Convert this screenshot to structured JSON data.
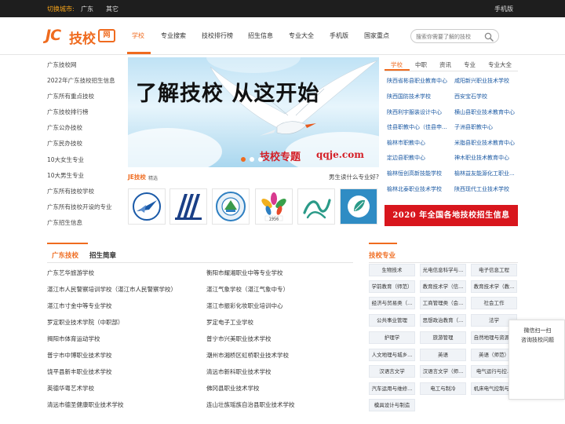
{
  "topbar": {
    "city_label": "切换城市:",
    "cities": [
      "广东",
      "其它"
    ],
    "mobile": "手机版"
  },
  "header": {
    "logo": {
      "jc": "JC",
      "word": "技校",
      "net": "网"
    },
    "nav": [
      "学校",
      "专业搜索",
      "技校排行榜",
      "招生信息",
      "专业大全",
      "手机版",
      "国家重点"
    ],
    "active_nav": 0,
    "search_placeholder": "搜索你需要了解的技校"
  },
  "left_list": [
    "广东技校网",
    "2022年广东技校招生信息",
    "广东所有重点技校",
    "广东技校排行榜",
    "广东公办技校",
    "广东民办技校",
    "10大女生专业",
    "10大男生专业",
    "广东所有技校学校",
    "广东所有技校开设的专业",
    "广东招生信息"
  ],
  "banner": {
    "headline": "了解技校 从这开始",
    "subline": "技校专题",
    "url": "qqje.com",
    "slide_count": 3,
    "active_slide": 0
  },
  "strip": {
    "brand": "JE技校",
    "brand_sub": "精选",
    "question": "男生读什么专业好?",
    "logo_colors": [
      "#1a5aa8",
      "#1a3f86",
      "#2e7fc1",
      "#d83a8f",
      "#2a9a88",
      "#2f8cc4"
    ],
    "logo_icons": [
      "plane-emblem-icon",
      "stripes-emblem-icon",
      "round-seal-icon",
      "flower-emblem-icon",
      "wave-emblem-icon",
      "circle-leaf-icon"
    ]
  },
  "right_tabs": [
    "学校",
    "中职",
    "资讯",
    "专业",
    "专业大全"
  ],
  "right_list": [
    [
      "陕西省彬县职业教育中心",
      "咸阳新兴职业技术学校"
    ],
    [
      "陕西国防技术学校",
      "西安宝石学校"
    ],
    [
      "陕西利宇服装设计中心",
      "横山县职业技术教育中心"
    ],
    [
      "佳县职教中心（佳县申...",
      "子洲县职教中心"
    ],
    [
      "榆林市职教中心",
      "米脂县职业技术教育中心"
    ],
    [
      "定边县职教中心",
      "神木职业技术教育中心"
    ],
    [
      "榆林恒创高新技能学校",
      "榆林益友能源化工职业..."
    ],
    [
      "榆林北泰职业技术学校",
      "陕西现代工业技术学校"
    ]
  ],
  "promo": "2020 年全国各地技校招生信息",
  "lower_tabs": [
    "广东技校",
    "招生简章"
  ],
  "schools": [
    [
      "广东艺华旅游学校",
      "衡阳市耀湘职业中等专业学校"
    ],
    [
      "湛江市人民警察培训学校（湛江市人民警察学校）",
      "湛江气象学校（湛江气象中专）"
    ],
    [
      "湛江市寸金中等专业学校",
      "湛江市振彩化妆职业培训中心"
    ],
    [
      "罗定职业技术学院（中职部）",
      "罗定电子工业学校"
    ],
    [
      "揭阳市体育运动学校",
      "普宁市兴美职业技术学校"
    ],
    [
      "普宁市中博职业技术学校",
      "潮州市湘桥区虹桥职业技术学校"
    ],
    [
      "饶平县新丰职业技术学校",
      "清远市新科职业技术学校"
    ],
    [
      "英德华粤艺术学校",
      "佛冈县职业技术学校"
    ],
    [
      "清远市德圣健康职业技术学校",
      "连山壮族瑶族自治县职业技术学校"
    ]
  ],
  "major_head": "技校专业",
  "majors": [
    [
      "生物技术",
      "光电信息科学与...",
      "电子信息工程"
    ],
    [
      "学前教育（师范）",
      "教育技术学（信...",
      "教育技术学（教..."
    ],
    [
      "经济与贸易类（...",
      "工商管理类（会...",
      "社会工作"
    ],
    [
      "公共事业管理",
      "思想政治教育（...",
      "法学"
    ],
    [
      "护理学",
      "旅游管理",
      "自然地理与资源..."
    ],
    [
      "人文地理与城乡...",
      "英语",
      "英语（师范）"
    ],
    [
      "汉语言文学",
      "汉语言文学（师...",
      "电气运行与控..."
    ],
    [
      "汽车运用与维修...",
      "电工与制冷",
      "机床电气控制与..."
    ],
    [
      "模具设计与制造"
    ]
  ],
  "qr": {
    "line1": "微信扫一扫",
    "line2": "咨询技校问题"
  }
}
